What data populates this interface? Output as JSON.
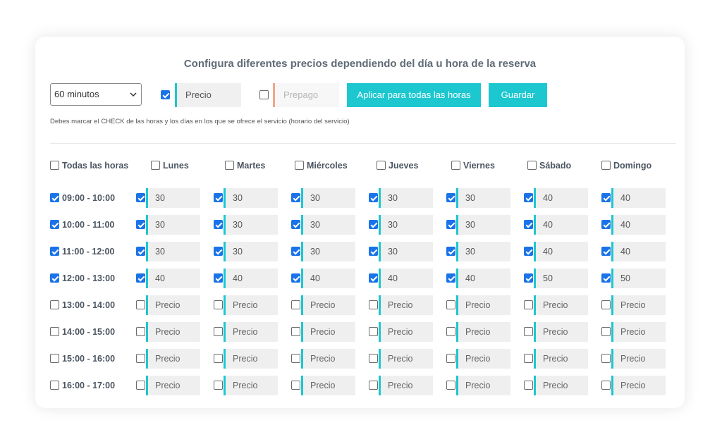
{
  "title": "Configura diferentes precios dependiendo del día u hora de la reserva",
  "toolbar": {
    "duration_value": "60 minutos",
    "price_checked": true,
    "price_placeholder": "Precio",
    "prepago_checked": false,
    "prepago_placeholder": "Prepago",
    "apply_label": "Aplicar para todas las horas",
    "save_label": "Guardar"
  },
  "hint": "Debes marcar el CHECK de las horas y los días en los que se ofrece el servicio (horario del servicio)",
  "all_hours_label": "Todas las horas",
  "days": [
    "Lunes",
    "Martes",
    "Miércoles",
    "Jueves",
    "Viernes",
    "Sábado",
    "Domingo"
  ],
  "price_placeholder": "Precio",
  "rows": [
    {
      "hour": "09:00 - 10:00",
      "checked": true,
      "prices": [
        "30",
        "30",
        "30",
        "30",
        "30",
        "40",
        "40"
      ]
    },
    {
      "hour": "10:00 - 11:00",
      "checked": true,
      "prices": [
        "30",
        "30",
        "30",
        "30",
        "30",
        "40",
        "40"
      ]
    },
    {
      "hour": "11:00 - 12:00",
      "checked": true,
      "prices": [
        "30",
        "30",
        "30",
        "30",
        "30",
        "40",
        "40"
      ]
    },
    {
      "hour": "12:00 - 13:00",
      "checked": true,
      "prices": [
        "40",
        "40",
        "40",
        "40",
        "40",
        "50",
        "50"
      ]
    },
    {
      "hour": "13:00 - 14:00",
      "checked": false,
      "prices": [
        "",
        "",
        "",
        "",
        "",
        "",
        ""
      ]
    },
    {
      "hour": "14:00 - 15:00",
      "checked": false,
      "prices": [
        "",
        "",
        "",
        "",
        "",
        "",
        ""
      ]
    },
    {
      "hour": "15:00 - 16:00",
      "checked": false,
      "prices": [
        "",
        "",
        "",
        "",
        "",
        "",
        ""
      ]
    },
    {
      "hour": "16:00 - 17:00",
      "checked": false,
      "prices": [
        "",
        "",
        "",
        "",
        "",
        "",
        ""
      ]
    }
  ],
  "colors": {
    "accent": "#1cc7d0",
    "checkbox": "#1a73e8",
    "prepago_border": "#f0a58a"
  }
}
